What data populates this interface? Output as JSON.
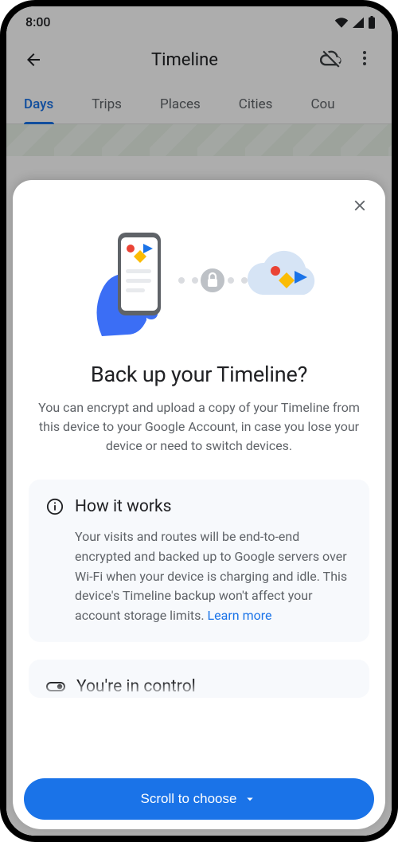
{
  "statusBar": {
    "time": "8:00"
  },
  "header": {
    "title": "Timeline"
  },
  "tabs": {
    "items": [
      {
        "label": "Days",
        "active": true
      },
      {
        "label": "Trips",
        "active": false
      },
      {
        "label": "Places",
        "active": false
      },
      {
        "label": "Cities",
        "active": false
      },
      {
        "label": "Cou",
        "active": false
      }
    ]
  },
  "sheet": {
    "title": "Back up your Timeline?",
    "subtitle": "You can encrypt and upload a copy of your Timeline from this device to your Google Account, in case you lose your device or need to switch devices.",
    "sections": {
      "howItWorks": {
        "title": "How it works",
        "body": "Your visits and routes will be end-to-end encrypted and backed up to Google servers over Wi-Fi when your device is charging and idle. This device's Timeline backup won't affect your account storage limits.",
        "learnMore": "Learn more"
      },
      "inControl": {
        "title": "You're in control"
      }
    },
    "cta": "Scroll to choose"
  },
  "colors": {
    "accent": "#1a73e8"
  }
}
